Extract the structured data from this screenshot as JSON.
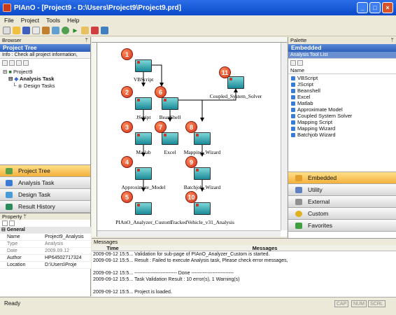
{
  "window": {
    "title": "PIAnO - [Project9 - D:\\Users\\Project9\\Project9.prd]",
    "buttons": [
      "_",
      "□",
      "×"
    ]
  },
  "menu": [
    "File",
    "Project",
    "Tools",
    "Help"
  ],
  "browser": {
    "caption": "Browser",
    "header": "Project Tree",
    "info": "Info : Check all project information,",
    "tree": [
      "Project9",
      "Analysis Task",
      "Design Tasks"
    ]
  },
  "nav": [
    "Project Tree",
    "Analysis Task",
    "Design Task",
    "Result History"
  ],
  "property": {
    "caption": "Property",
    "group": "General",
    "rows": [
      {
        "k": "Name",
        "v": "Project9_Analysis"
      },
      {
        "k": "Type",
        "v": "Analysis"
      },
      {
        "k": "Date",
        "v": "2009.09.12"
      },
      {
        "k": "Author",
        "v": "HP64502717324"
      },
      {
        "k": "Location",
        "v": "D:\\Users\\Proje"
      }
    ]
  },
  "flow": {
    "nodes": [
      {
        "n": "1",
        "label": "VBScript"
      },
      {
        "n": "2",
        "label": "JScript"
      },
      {
        "n": "3",
        "label": "Matlab"
      },
      {
        "n": "4",
        "label": "Approximate_Model"
      },
      {
        "n": "5",
        "label": "PIAnO_Analyzer_Custom"
      },
      {
        "n": "6",
        "label": "BeanShell"
      },
      {
        "n": "7",
        "label": "Excel"
      },
      {
        "n": "8",
        "label": "Mapping_Wizard"
      },
      {
        "n": "9",
        "label": "Batchjob_Wizard"
      },
      {
        "n": "10",
        "label": "TrackedVehicle_v31_Analysis"
      },
      {
        "n": "11",
        "label": "Coupled_System_Solver"
      }
    ]
  },
  "palette": {
    "caption": "Palette",
    "header": "Embedded",
    "subheader": "Analysis Tool List",
    "list_header": "Name",
    "items": [
      "VBScript",
      "JScript",
      "Beanshell",
      "Excel",
      "Matlab",
      "Approximate Model",
      "Coupled System Solver",
      "Mapping Script",
      "Mapping Wizard",
      "Batchjob Wizard"
    ],
    "categories": [
      "Embedded",
      "Utility",
      "External",
      "Custom",
      "Favorites"
    ]
  },
  "messages": {
    "caption": "Messages",
    "col_time": "Time",
    "col_msg": "Messages",
    "rows": [
      {
        "t": "2009-09-12 15:5...",
        "m": "Validation for sub-page of PIAnO_Analyzer_Custom is started."
      },
      {
        "t": "2009-09-12 15:5...",
        "m": "Result : Failed to execute Analysis task, Please check error messages,"
      },
      {
        "t": "",
        "m": ""
      },
      {
        "t": "2009-09-12 15:5...",
        "m": "-------------------------- Done --------------------------"
      },
      {
        "t": "2009-09-12 15:5...",
        "m": "Task Validation Result : 10 error(s), 1 Warning(s)"
      },
      {
        "t": "",
        "m": ""
      },
      {
        "t": "2009-09-12 15:5...",
        "m": "Project is loaded."
      }
    ]
  },
  "status": {
    "text": "Ready",
    "caps": "CAP",
    "num": "NUM",
    "scrl": "SCRL"
  }
}
